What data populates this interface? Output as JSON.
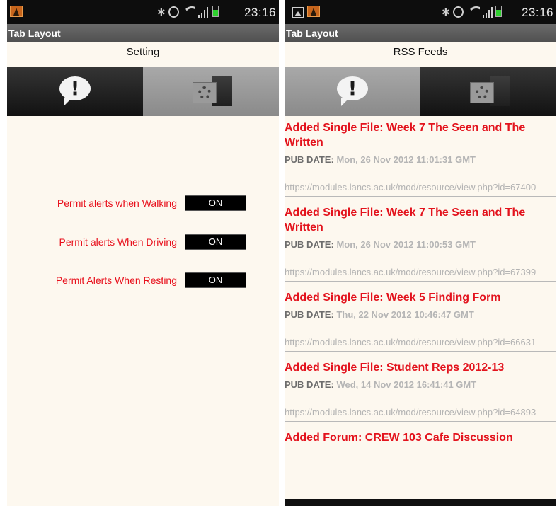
{
  "left_screen": {
    "status": {
      "time": "23:16",
      "icons": [
        "warning-app-icon",
        "bluetooth-icon",
        "alarm-icon",
        "wifi-icon",
        "signal-icon",
        "battery-icon"
      ]
    },
    "app_title": "Tab Layout",
    "screen_title": "Setting",
    "tabs": [
      {
        "icon": "alert-bubble-icon",
        "selected": false
      },
      {
        "icon": "settings-folder-icon",
        "selected": true
      }
    ],
    "settings": [
      {
        "label": "Permit alerts when Walking",
        "value": "ON"
      },
      {
        "label": "Permit alerts When Driving",
        "value": "ON"
      },
      {
        "label": "Permit Alerts When Resting",
        "value": "ON"
      }
    ]
  },
  "right_screen": {
    "status": {
      "time": "23:16",
      "icons": [
        "picture-icon",
        "warning-app-icon",
        "bluetooth-icon",
        "alarm-icon",
        "wifi-icon",
        "signal-icon",
        "battery-icon"
      ]
    },
    "app_title": "Tab Layout",
    "screen_title": "RSS Feeds",
    "tabs": [
      {
        "icon": "alert-bubble-icon",
        "selected": true
      },
      {
        "icon": "settings-folder-icon",
        "selected": false
      }
    ],
    "pub_label": "PUB DATE:",
    "feed": [
      {
        "title": "Added Single File: Week 7 The Seen and The Written",
        "date": "Mon, 26 Nov 2012 11:01:31 GMT",
        "link": "https://modules.lancs.ac.uk/mod/resource/view.php?id=67400"
      },
      {
        "title": "Added Single File: Week 7 The Seen and The Written",
        "date": "Mon, 26 Nov 2012 11:00:53 GMT",
        "link": "https://modules.lancs.ac.uk/mod/resource/view.php?id=67399"
      },
      {
        "title": "Added Single File: Week 5 Finding Form",
        "date": "Thu, 22 Nov 2012 10:46:47 GMT",
        "link": "https://modules.lancs.ac.uk/mod/resource/view.php?id=66631"
      },
      {
        "title": "Added Single File: Student Reps 2012-13",
        "date": "Wed, 14 Nov 2012 16:41:41 GMT",
        "link": "https://modules.lancs.ac.uk/mod/resource/view.php?id=64893"
      },
      {
        "title": "Added Forum: CREW 103 Cafe Discussion",
        "date": "",
        "link": ""
      }
    ]
  },
  "colors": {
    "accent_red": "#e3131d",
    "tab_dark": "#1a1a1a",
    "tab_light": "#9a9a9a",
    "background": "#fdf8ef"
  }
}
